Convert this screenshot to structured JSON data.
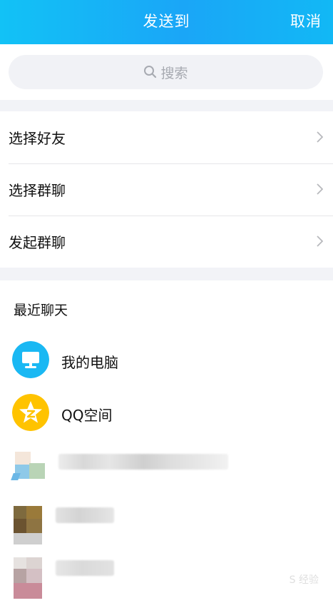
{
  "header": {
    "title": "发送到",
    "cancel_label": "取消",
    "gradient_colors": [
      "#12c2f6",
      "#1aa6f7"
    ]
  },
  "search": {
    "placeholder": "搜索"
  },
  "menu": {
    "items": [
      {
        "label": "选择好友"
      },
      {
        "label": "选择群聊"
      },
      {
        "label": "发起群聊"
      }
    ]
  },
  "recent": {
    "title": "最近聊天",
    "contacts": [
      {
        "name": "我的电脑",
        "icon": "computer-icon",
        "color": "#1ab8f3"
      },
      {
        "name": "QQ空间",
        "icon": "qzone-star-icon",
        "color": "#ffc300"
      },
      {
        "name": "",
        "icon": "blurred-avatar"
      },
      {
        "name": "",
        "icon": "blurred-avatar"
      },
      {
        "name": "",
        "icon": "blurred-avatar"
      }
    ]
  },
  "watermark": "S 经验"
}
